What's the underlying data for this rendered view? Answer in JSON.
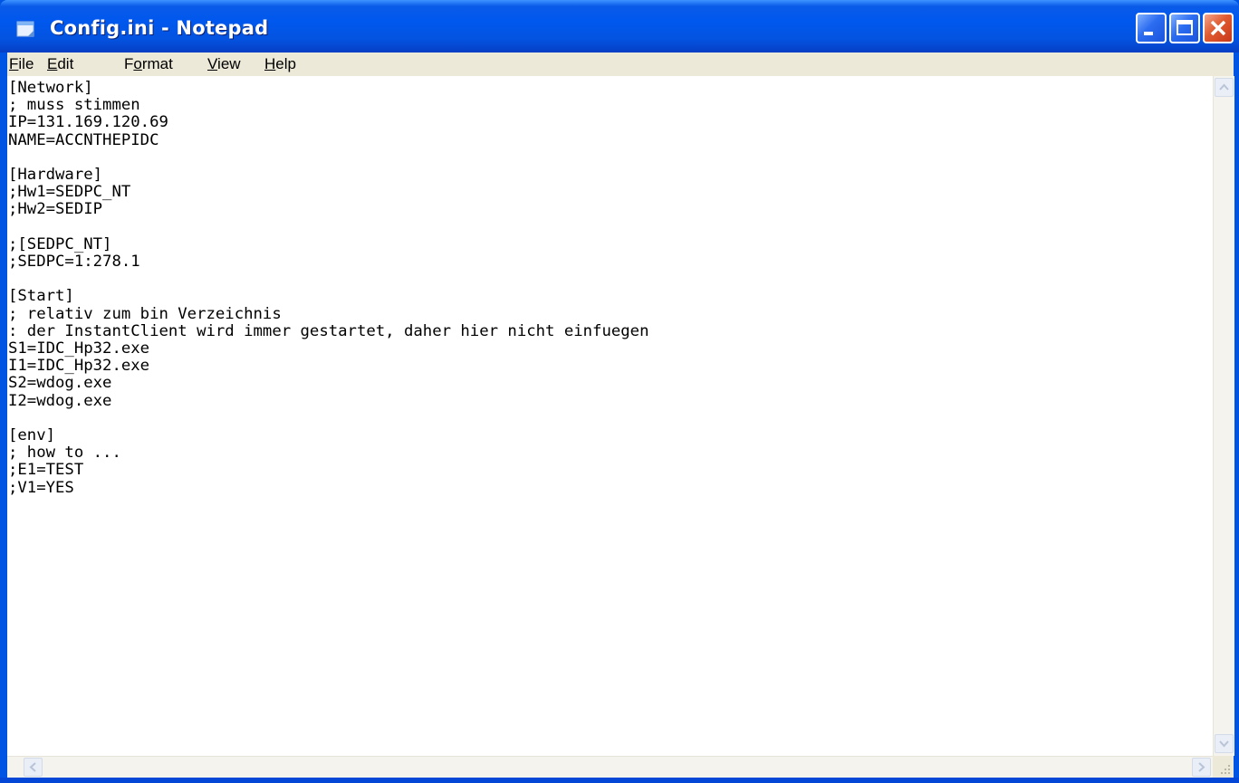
{
  "window": {
    "title": "Config.ini - Notepad"
  },
  "menu": [
    {
      "accel": "F",
      "rest": "ile"
    },
    {
      "accel": "E",
      "rest": "dit"
    },
    {
      "pre": "F",
      "accel": "o",
      "rest": "rmat"
    },
    {
      "accel": "V",
      "rest": "iew"
    },
    {
      "accel": "H",
      "rest": "elp"
    }
  ],
  "document": {
    "content": "[Network]\n; muss stimmen\nIP=131.169.120.69\nNAME=ACCNTHEPIDC\n\n[Hardware]\n;Hw1=SEDPC_NT\n;Hw2=SEDIP\n\n;[SEDPC_NT]\n;SEDPC=1:278.1\n\n[Start]\n; relativ zum bin Verzeichnis\n: der InstantClient wird immer gestartet, daher hier nicht einfuegen\nS1=IDC_Hp32.exe\nI1=IDC_Hp32.exe\nS2=wdog.exe\nI2=wdog.exe\n\n[env]\n; how to ...\n;E1=TEST\n;V1=YES"
  },
  "icons": {
    "app": "notepad-icon",
    "minimize": "minimize-icon",
    "maximize": "maximize-icon",
    "close": "close-icon",
    "scroll_up": "arrow-up-icon",
    "scroll_down": "arrow-down-icon",
    "scroll_left": "arrow-left-icon",
    "scroll_right": "arrow-right-icon",
    "resize": "resize-grip-icon"
  },
  "colors": {
    "titlebar": "#0058ee",
    "menubar": "#ece9d8",
    "editor_bg": "#ffffff",
    "close_button": "#e05a30"
  }
}
